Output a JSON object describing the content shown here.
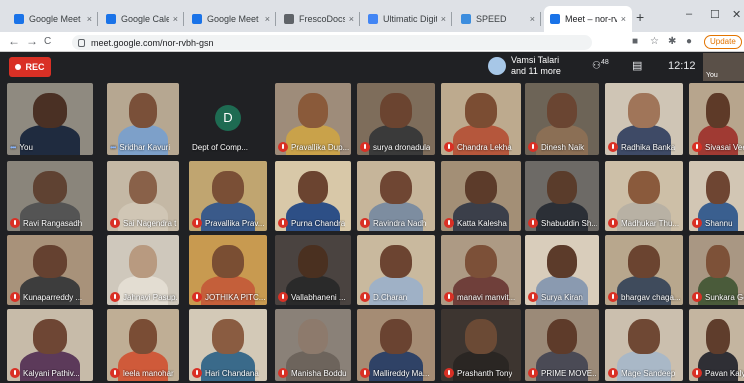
{
  "browser": {
    "tabs": [
      {
        "label": "Google Meet",
        "favcolor": "#1a73e8",
        "close": "×"
      },
      {
        "label": "Google Calendar",
        "favcolor": "#1a73e8",
        "close": "×"
      },
      {
        "label": "Google Meet",
        "favcolor": "#1a73e8",
        "close": "×"
      },
      {
        "label": "FrescoDocs",
        "favcolor": "#5f6368",
        "close": "×"
      },
      {
        "label": "Ultimatic Digital",
        "favcolor": "#4285f4",
        "close": "×"
      },
      {
        "label": "SPEED",
        "favcolor": "#3c8dde",
        "close": "×"
      },
      {
        "label": "Meet – nor-rvbh",
        "favcolor": "#1a73e8",
        "close": "×"
      }
    ],
    "new_tab": "+",
    "window": {
      "minimize": "–",
      "maximize": "☐",
      "close": "✕"
    },
    "nav": {
      "back": "←",
      "forward": "→",
      "reload": "C",
      "home": "⌂"
    },
    "url": "meet.google.com/nor-rvbh-gsn",
    "update_label": "Update"
  },
  "meet": {
    "rec_label": "REC",
    "presenter_name": "Vamsi Talari",
    "presenter_more": "and 11 more",
    "people_count": "48",
    "time": "12:12",
    "self_label": "You"
  },
  "participants": [
    [
      {
        "name": "You",
        "talking": true,
        "bg": "#8f8a80",
        "skin": "#4a3024",
        "shirt": "#1f2b3f"
      },
      {
        "name": "Sridhar Kavuri",
        "talking": true,
        "bg": "#b6a791",
        "skin": "#7a5039",
        "shirt": "#7da0c9"
      },
      {
        "name": "Dept of Comp...",
        "initial": "D",
        "bg": "#202124"
      },
      {
        "name": "Pravallika Dup...",
        "muted": true,
        "bg": "#9e8c7a",
        "skin": "#8a5a3a",
        "shirt": "#c9a24a"
      },
      {
        "name": "surya dronadula",
        "muted": true,
        "bg": "#7e6d5b",
        "skin": "#6b4430",
        "shirt": "#3a3a3a"
      },
      {
        "name": "Chandra Lekha",
        "muted": true,
        "bg": "#bdaa8e",
        "skin": "#7b4d33",
        "shirt": "#b5573c"
      },
      {
        "name": "Dinesh Naik",
        "muted": true,
        "bg": "#6d6457",
        "skin": "#6a4532",
        "shirt": "#8b6f55"
      },
      {
        "name": "Radhika Banka",
        "muted": true,
        "bg": "#cfc5b5",
        "skin": "#a07559",
        "shirt": "#3e4a66"
      },
      {
        "name": "Sivasai Veerla",
        "muted": true,
        "bg": "#b7a58d",
        "skin": "#5e3a28",
        "shirt": "#a03a33"
      }
    ],
    [
      {
        "name": "Ravi Rangasadh",
        "muted": true,
        "bg": "#8a857b",
        "skin": "#5f4232",
        "shirt": "#545454"
      },
      {
        "name": "Sai Nagendra t...",
        "muted": true,
        "bg": "#c4b8a5",
        "skin": "#896149",
        "shirt": "#d0c6b5"
      },
      {
        "name": "Pravallika Prav...",
        "muted": true,
        "bg": "#c0a570",
        "skin": "#7a4f36",
        "shirt": "#3a5a8a"
      },
      {
        "name": "Purna Chandra",
        "muted": true,
        "bg": "#d8c8a8",
        "skin": "#6b4430",
        "shirt": "#2d4f86"
      },
      {
        "name": "Ravindra Nadh",
        "muted": true,
        "bg": "#c6b59a",
        "skin": "#6f4633",
        "shirt": "#7d8da0"
      },
      {
        "name": "Katta Kalesha",
        "muted": true,
        "bg": "#a38f76",
        "skin": "#5c3b2a",
        "shirt": "#3b3f4a"
      },
      {
        "name": "Shabuddin Sh...",
        "muted": true,
        "bg": "#6d6a66",
        "skin": "#5a3c2b",
        "shirt": "#2b2f36"
      },
      {
        "name": "Madhukar Thu...",
        "muted": true,
        "bg": "#cdbfa7",
        "skin": "#8a5a3c",
        "shirt": "#b8b1a4"
      },
      {
        "name": "Shannu",
        "muted": true,
        "bg": "#d2c6b4",
        "skin": "#6e4532",
        "shirt": "#3a5f8f"
      }
    ],
    [
      {
        "name": "Kunaparreddy ...",
        "muted": true,
        "bg": "#a8927a",
        "skin": "#654130",
        "shirt": "#3d3d3d"
      },
      {
        "name": "Jahnavi Pasup...",
        "muted": true,
        "bg": "#cfc8bc",
        "skin": "#b89a80",
        "shirt": "#e3ddd2"
      },
      {
        "name": "JOTHIKA PITC...",
        "muted": true,
        "bg": "#c89a50",
        "skin": "#7a4e33",
        "shirt": "#c45f3a"
      },
      {
        "name": "Vallabhaneni ...",
        "muted": true,
        "bg": "#4a4340",
        "skin": "#4a3020",
        "shirt": "#2a2a2a"
      },
      {
        "name": "D.Charan",
        "muted": true,
        "bg": "#c9b99e",
        "skin": "#6c4431",
        "shirt": "#9fb1c6"
      },
      {
        "name": "manavi manvit...",
        "muted": true,
        "bg": "#ad9a84",
        "skin": "#7c5038",
        "shirt": "#6f3f3a"
      },
      {
        "name": "Surya Kiran",
        "muted": true,
        "bg": "#d9cdbb",
        "skin": "#5c3b2a",
        "shirt": "#8a9ab0"
      },
      {
        "name": "bhargav chaga...",
        "muted": true,
        "bg": "#b8a78d",
        "skin": "#6b4430",
        "shirt": "#3f4b5c"
      },
      {
        "name": "Sunkara Geetha",
        "muted": true,
        "bg": "#a99783",
        "skin": "#7d5138",
        "shirt": "#4a5b3a"
      }
    ],
    [
      {
        "name": "Kalyani Pathiv...",
        "muted": true,
        "bg": "#c7bba9",
        "skin": "#6e4634",
        "shirt": "#5c3a5a"
      },
      {
        "name": "leela manohar",
        "muted": true,
        "bg": "#bfae95",
        "skin": "#7a4d35",
        "shirt": "#cf5a3a"
      },
      {
        "name": "Hari Chandana",
        "muted": true,
        "bg": "#d3c9b7",
        "skin": "#8a5c41",
        "shirt": "#3a6a8a"
      },
      {
        "name": "Manisha Boddu",
        "muted": true,
        "bg": "#8a8178",
        "skin": "#8d7a6c",
        "shirt": "#6d645c"
      },
      {
        "name": "Mallireddy Ma...",
        "muted": true,
        "bg": "#a58c74",
        "skin": "#6a4331",
        "shirt": "#2f4266"
      },
      {
        "name": "Prashanth Tony",
        "muted": true,
        "bg": "#3d3530",
        "skin": "#6b4a35",
        "shirt": "#2a2623"
      },
      {
        "name": "PRIME MOVE...",
        "muted": true,
        "bg": "#9b8a78",
        "skin": "#5e3b2a",
        "shirt": "#4a4a55"
      },
      {
        "name": "Mage Sandeep",
        "muted": true,
        "bg": "#cbbfae",
        "skin": "#6f4834",
        "shirt": "#a9b8c7"
      },
      {
        "name": "Pavan Kalyan ...",
        "muted": true,
        "bg": "#c4b5a0",
        "skin": "#5f3d2c",
        "shirt": "#2f2f35"
      }
    ]
  ]
}
